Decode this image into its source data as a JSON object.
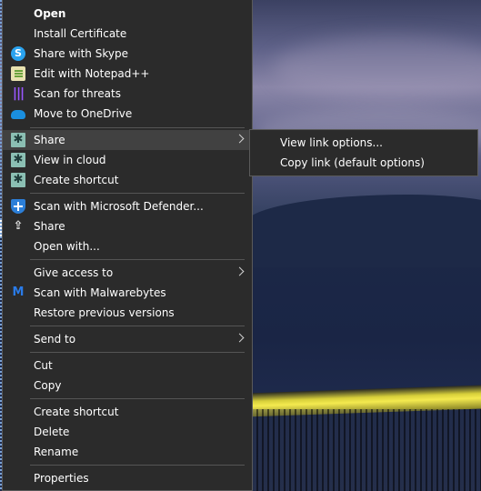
{
  "context_menu": {
    "items": [
      {
        "label": "Open"
      },
      {
        "label": "Install Certificate"
      },
      {
        "label": "Share with Skype",
        "icon": "skype-icon"
      },
      {
        "label": "Edit with Notepad++",
        "icon": "notepad-plus-plus-icon"
      },
      {
        "label": "Scan for threats",
        "icon": "threat-scan-icon"
      },
      {
        "label": "Move to OneDrive",
        "icon": "onedrive-cloud-icon"
      },
      {
        "label": "Share",
        "icon": "share-app-icon"
      },
      {
        "label": "View in cloud",
        "icon": "share-app-icon"
      },
      {
        "label": "Create shortcut",
        "icon": "share-app-icon"
      },
      {
        "label": "Scan with Microsoft Defender...",
        "icon": "defender-shield-icon"
      },
      {
        "label": "Share",
        "icon": "share-arrow-icon"
      },
      {
        "label": "Open with..."
      },
      {
        "label": "Give access to"
      },
      {
        "label": "Scan with Malwarebytes",
        "icon": "malwarebytes-icon"
      },
      {
        "label": "Restore previous versions"
      },
      {
        "label": "Send to"
      },
      {
        "label": "Cut"
      },
      {
        "label": "Copy"
      },
      {
        "label": "Create shortcut"
      },
      {
        "label": "Delete"
      },
      {
        "label": "Rename"
      },
      {
        "label": "Properties"
      }
    ]
  },
  "share_submenu": {
    "items": [
      {
        "label": "View link options..."
      },
      {
        "label": "Copy link (default options)"
      }
    ]
  },
  "colors": {
    "menu_background": "#2b2b2b",
    "menu_hover": "#414141",
    "separator": "#555555",
    "text": "#ffffff"
  }
}
